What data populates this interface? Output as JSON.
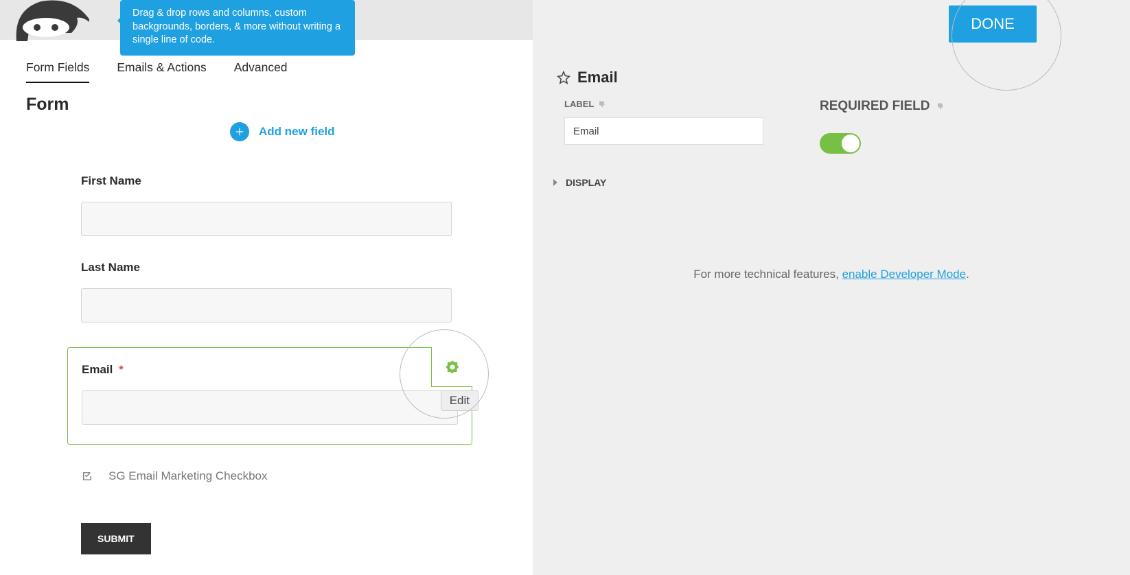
{
  "tooltip": "Drag & drop rows and columns, custom backgrounds, borders, & more without writing a single line of code.",
  "tabs": {
    "form_fields": "Form Fields",
    "emails_actions": "Emails & Actions",
    "advanced": "Advanced"
  },
  "form_heading": "Form",
  "add_new_field": "Add new field",
  "fields": {
    "first_name": {
      "label": "First Name"
    },
    "last_name": {
      "label": "Last Name"
    },
    "email": {
      "label": "Email",
      "required_mark": "*"
    },
    "checkbox": {
      "label": "SG Email Marketing Checkbox"
    }
  },
  "edit_tooltip": "Edit",
  "submit": "SUBMIT",
  "done": "DONE",
  "settings": {
    "title": "Email",
    "label_section": "LABEL",
    "label_value": "Email",
    "required_section": "REQUIRED FIELD",
    "required_on": true,
    "display_section": "DISPLAY"
  },
  "dev_mode": {
    "prefix": "For more technical features, ",
    "link": "enable Developer Mode",
    "suffix": "."
  }
}
